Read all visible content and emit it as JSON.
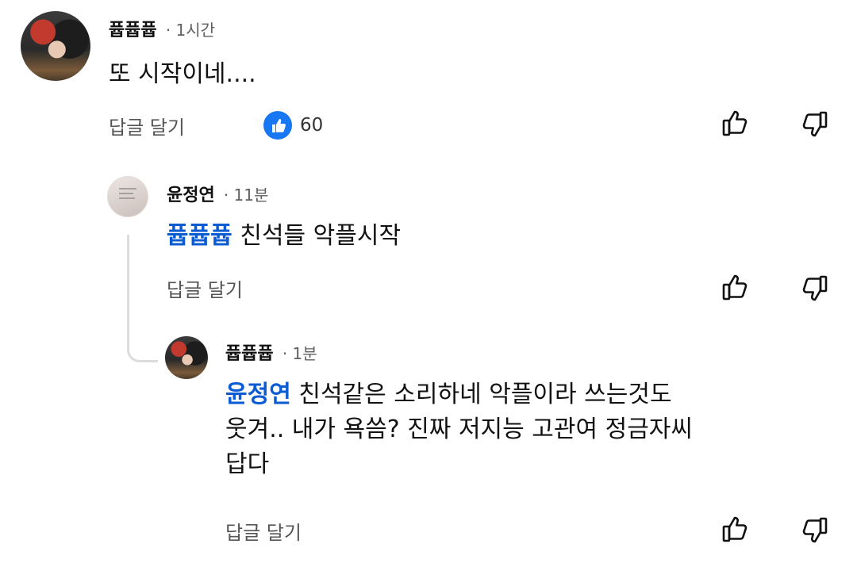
{
  "comments": [
    {
      "author": "퓹퓹퓹",
      "time": "· 1시간",
      "text": "또 시작이네....",
      "reply_label": "답글 달기",
      "likes": "60"
    },
    {
      "author": "윤정연",
      "time": "· 11분",
      "mention": "퓹퓹퓹",
      "text": " 친석들 악플시작",
      "reply_label": "답글 달기"
    },
    {
      "author": "퓹퓹퓹",
      "time": "· 1분",
      "mention": "윤정연",
      "text_lines": [
        " 친석같은 소리하네 악플이라 쓰는것도",
        "웃겨.. 내가 욕씀? 진짜 저지능 고관여 정금자씨",
        "답다"
      ],
      "reply_label": "답글 달기"
    }
  ],
  "colors": {
    "mention": "#0b5bd3",
    "like_badge": "#1877f2",
    "thread_line": "#dcdcdc"
  },
  "icons": [
    "thumbs-up-icon",
    "thumbs-down-icon",
    "like-reaction-icon"
  ]
}
